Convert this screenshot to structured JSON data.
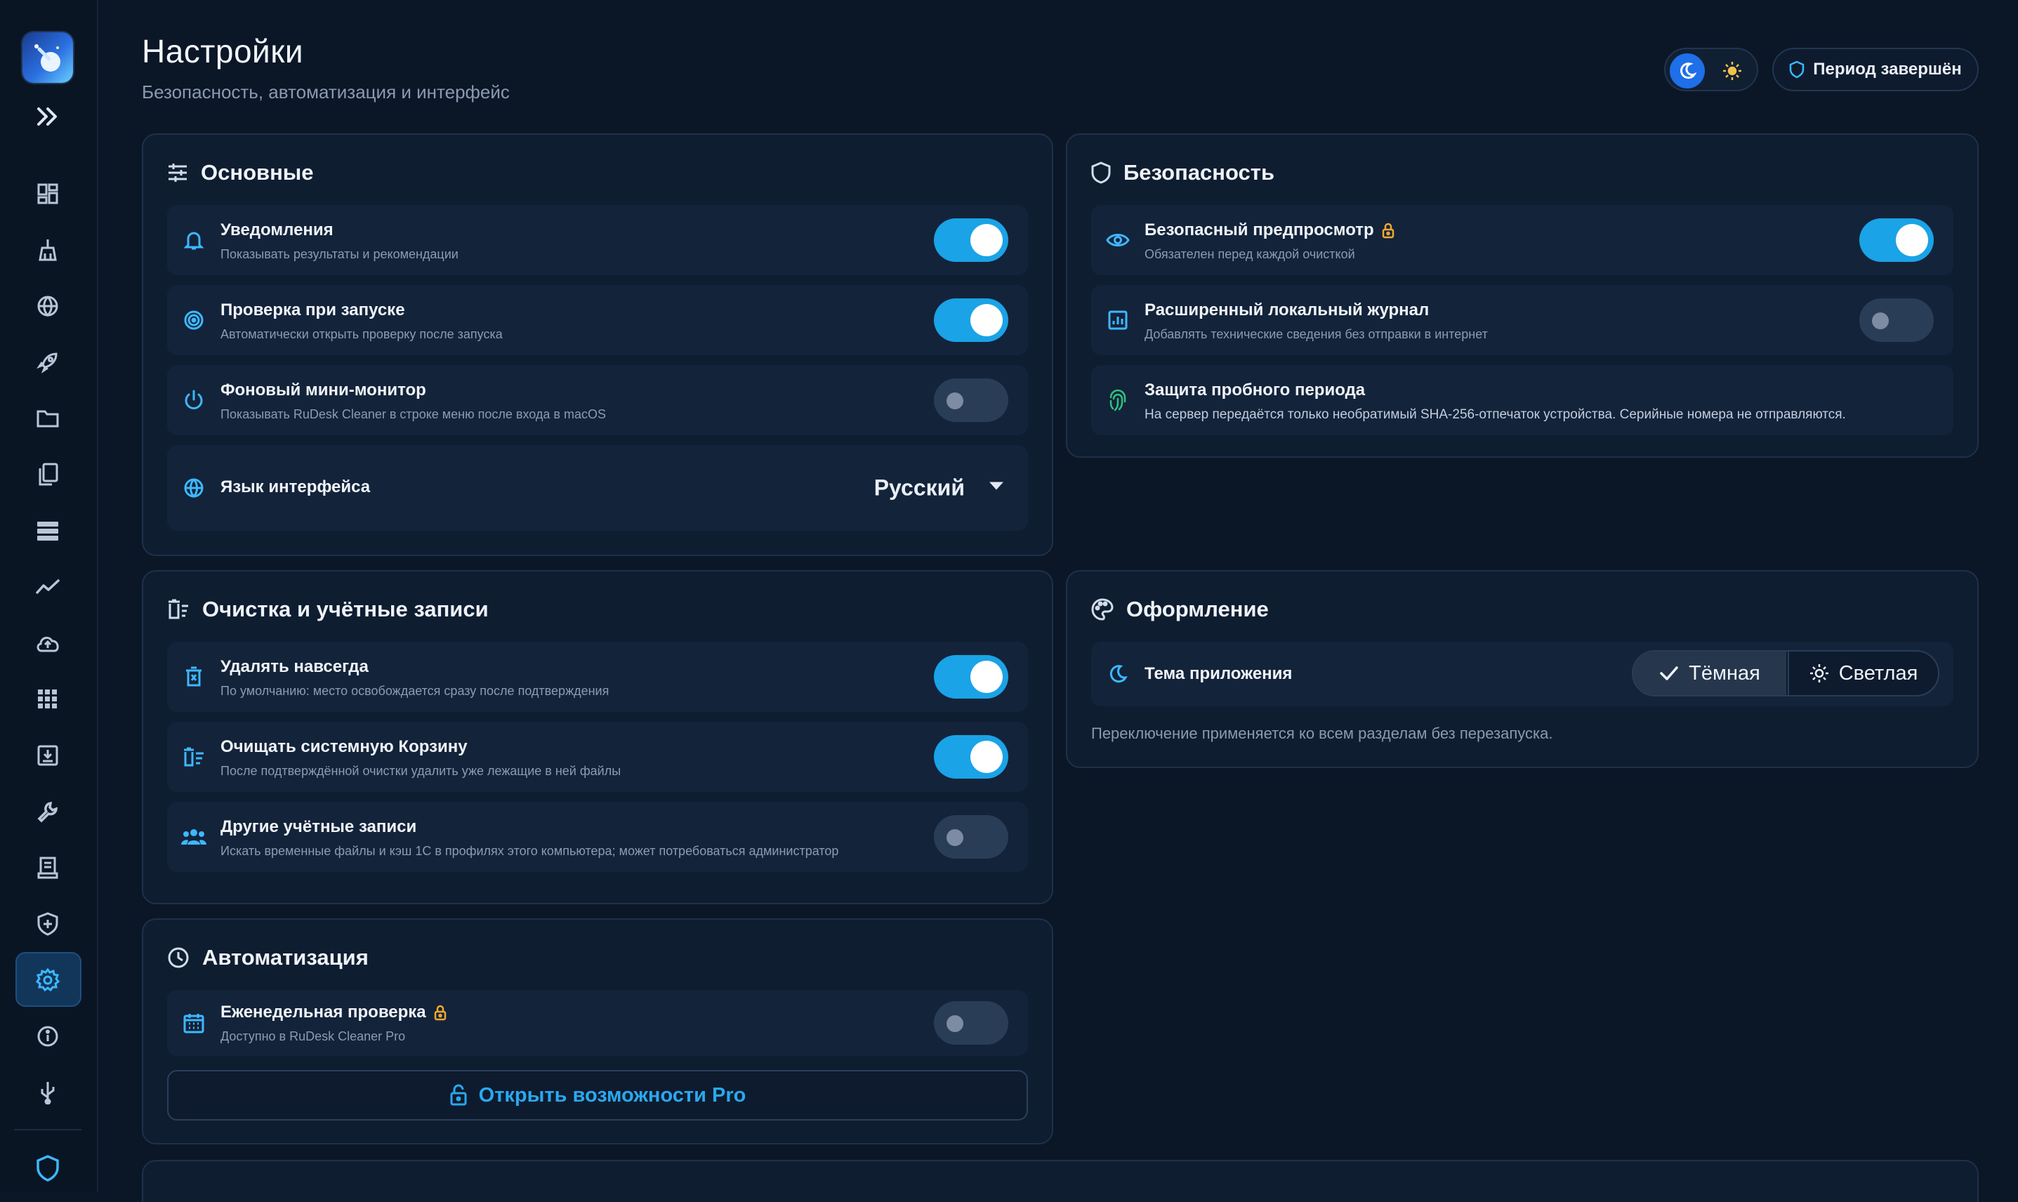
{
  "header": {
    "title": "Настройки",
    "subtitle": "Безопасность, автоматизация и интерфейс",
    "period_button": "Период завершён"
  },
  "sidebar": {
    "items": [
      {
        "icon": "dashboard-icon"
      },
      {
        "icon": "broom-icon"
      },
      {
        "icon": "globe-icon"
      },
      {
        "icon": "rocket-icon"
      },
      {
        "icon": "folder-icon"
      },
      {
        "icon": "copy-files-icon"
      },
      {
        "icon": "storage-icon"
      },
      {
        "icon": "activity-chart-icon"
      },
      {
        "icon": "cloud-upload-icon"
      },
      {
        "icon": "apps-grid-icon"
      },
      {
        "icon": "download-box-icon"
      },
      {
        "icon": "wrench-icon"
      },
      {
        "icon": "receipt-icon"
      },
      {
        "icon": "shield-plus-icon"
      },
      {
        "icon": "settings-gear-icon",
        "active": true
      },
      {
        "icon": "info-icon"
      },
      {
        "icon": "usb-icon"
      },
      {
        "icon": "shield-icon"
      }
    ]
  },
  "basic": {
    "title": "Основные",
    "rows": [
      {
        "title": "Уведомления",
        "desc": "Показывать результаты и рекомендации",
        "on": true
      },
      {
        "title": "Проверка при запуске",
        "desc": "Автоматически открыть проверку после запуска",
        "on": true
      },
      {
        "title": "Фоновый мини-монитор",
        "desc": "Показывать RuDesk Cleaner в строке меню после входа в macOS",
        "on": false
      }
    ],
    "language_label": "Язык интерфейса",
    "language_value": "Русский"
  },
  "security": {
    "title": "Безопасность",
    "rows": [
      {
        "title": "Безопасный предпросмотр",
        "desc": "Обязателен перед каждой очисткой",
        "on": true,
        "locked": true
      },
      {
        "title": "Расширенный локальный журнал",
        "desc": "Добавлять технические сведения без отправки в интернет",
        "on": false
      },
      {
        "title": "Защита пробного периода",
        "desc": "На сервер передаётся только необратимый SHA-256-отпечаток устройства. Серийные номера не отправляются."
      }
    ]
  },
  "cleanup": {
    "title": "Очистка и учётные записи",
    "rows": [
      {
        "title": "Удалять навсегда",
        "desc": "По умолчанию: место освобождается сразу после подтверждения",
        "on": true
      },
      {
        "title": "Очищать системную Корзину",
        "desc": "После подтверждённой очистки удалить уже лежащие в ней файлы",
        "on": true
      },
      {
        "title": "Другие учётные записи",
        "desc": "Искать временные файлы и кэш 1С в профилях этого компьютера; может потребоваться администратор",
        "on": false
      }
    ]
  },
  "appearance": {
    "title": "Оформление",
    "theme_label": "Тема приложения",
    "dark_label": "Тёмная",
    "light_label": "Светлая",
    "note": "Переключение применяется ко всем разделам без перезапуска."
  },
  "automation": {
    "title": "Автоматизация",
    "weekly_title": "Еженедельная проверка",
    "weekly_desc": "Доступно в RuDesk Cleaner Pro",
    "weekly_on": false,
    "pro_button": "Открыть возможности Pro"
  },
  "colors": {
    "accent": "#1aa3e6",
    "lock": "#f0a92e",
    "fingerprint": "#2ec27e"
  }
}
